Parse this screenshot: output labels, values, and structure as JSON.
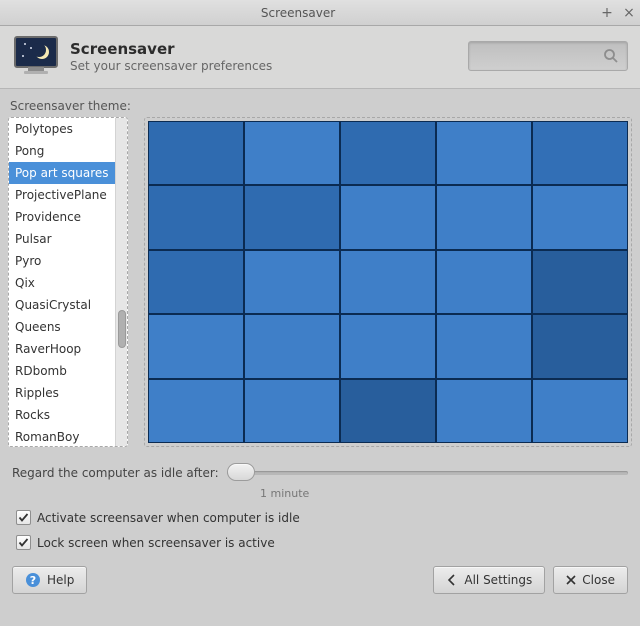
{
  "window": {
    "title": "Screensaver"
  },
  "header": {
    "title": "Screensaver",
    "subtitle": "Set your screensaver preferences"
  },
  "theme": {
    "label": "Screensaver theme:",
    "selected_index": 2,
    "items": [
      "Polytopes",
      "Pong",
      "Pop art squares",
      "ProjectivePlane",
      "Providence",
      "Pulsar",
      "Pyro",
      "Qix",
      "QuasiCrystal",
      "Queens",
      "RaverHoop",
      "RDbomb",
      "Ripples",
      "Rocks",
      "RomanBoy"
    ]
  },
  "preview": {
    "colors": [
      "#2f6bb0",
      "#3f7fc8",
      "#2f6bb0",
      "#3f7fc8",
      "#326fb6",
      "#2f6bb0",
      "#2f6bb0",
      "#3f7fc8",
      "#3f7fc8",
      "#3f7fc8",
      "#2f6bb0",
      "#3f7fc8",
      "#3f7fc8",
      "#3f7fc8",
      "#285e9c",
      "#3f7fc8",
      "#3f7fc8",
      "#3f7fc8",
      "#3f7fc8",
      "#285e9c",
      "#3f7fc8",
      "#3f7fc8",
      "#285e9c",
      "#3f7fc8",
      "#3f7fc8"
    ]
  },
  "idle": {
    "label": "Regard the computer as idle after:",
    "value_label": "1 minute"
  },
  "checks": {
    "activate": {
      "label": "Activate screensaver when computer is idle",
      "checked": true
    },
    "lock": {
      "label": "Lock screen when screensaver is active",
      "checked": true
    }
  },
  "footer": {
    "help": "Help",
    "all_settings": "All Settings",
    "close": "Close"
  }
}
